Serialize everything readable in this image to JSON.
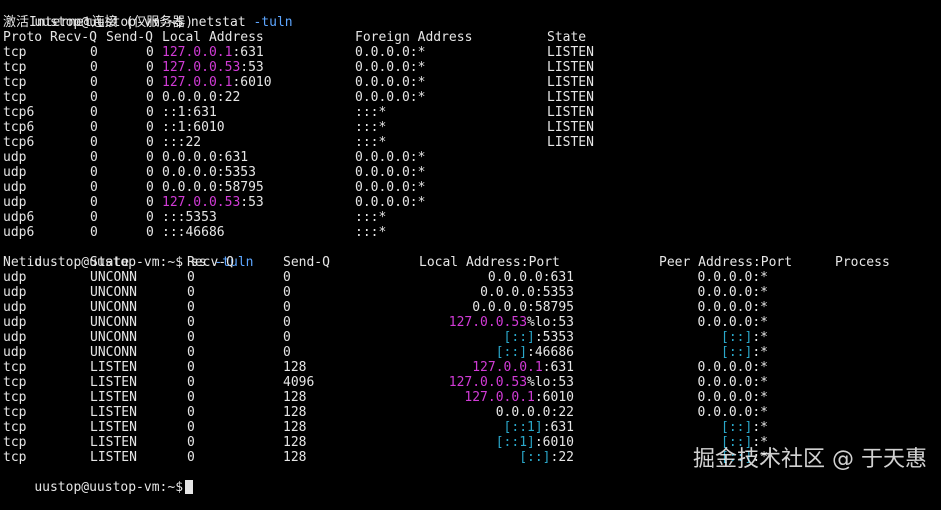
{
  "colors": {
    "background": "#000000",
    "text": "#e6e6e6",
    "ip_loopback": "#d13bd6",
    "ipv6_brackets": "#2aa7c9",
    "command_option": "#5da6ff"
  },
  "netstat": {
    "prompt": "uustop@uustop-vm:~$",
    "command": "netstat",
    "option": "-tuln",
    "subtitle": "激活Internet连接 (仅服务器)",
    "headers": {
      "proto": "Proto",
      "recvq": "Recv-Q",
      "sendq": "Send-Q",
      "local": "Local Address",
      "foreign": "Foreign Address",
      "state": "State"
    },
    "rows": [
      {
        "proto": "tcp",
        "recvq": "0",
        "sendq": "0",
        "local_ip": "127.0.0.1",
        "local_port": ":631",
        "foreign": "0.0.0.0:*",
        "state": "LISTEN"
      },
      {
        "proto": "tcp",
        "recvq": "0",
        "sendq": "0",
        "local_ip": "127.0.0.53",
        "local_port": ":53",
        "foreign": "0.0.0.0:*",
        "state": "LISTEN"
      },
      {
        "proto": "tcp",
        "recvq": "0",
        "sendq": "0",
        "local_ip": "127.0.0.1",
        "local_port": ":6010",
        "foreign": "0.0.0.0:*",
        "state": "LISTEN"
      },
      {
        "proto": "tcp",
        "recvq": "0",
        "sendq": "0",
        "local_ip": "",
        "local_port": "0.0.0.0:22",
        "foreign": "0.0.0.0:*",
        "state": "LISTEN"
      },
      {
        "proto": "tcp6",
        "recvq": "0",
        "sendq": "0",
        "local_ip": "",
        "local_port": "::1:631",
        "foreign": ":::*",
        "state": "LISTEN"
      },
      {
        "proto": "tcp6",
        "recvq": "0",
        "sendq": "0",
        "local_ip": "",
        "local_port": "::1:6010",
        "foreign": ":::*",
        "state": "LISTEN"
      },
      {
        "proto": "tcp6",
        "recvq": "0",
        "sendq": "0",
        "local_ip": "",
        "local_port": ":::22",
        "foreign": ":::*",
        "state": "LISTEN"
      },
      {
        "proto": "udp",
        "recvq": "0",
        "sendq": "0",
        "local_ip": "",
        "local_port": "0.0.0.0:631",
        "foreign": "0.0.0.0:*",
        "state": ""
      },
      {
        "proto": "udp",
        "recvq": "0",
        "sendq": "0",
        "local_ip": "",
        "local_port": "0.0.0.0:5353",
        "foreign": "0.0.0.0:*",
        "state": ""
      },
      {
        "proto": "udp",
        "recvq": "0",
        "sendq": "0",
        "local_ip": "",
        "local_port": "0.0.0.0:58795",
        "foreign": "0.0.0.0:*",
        "state": ""
      },
      {
        "proto": "udp",
        "recvq": "0",
        "sendq": "0",
        "local_ip": "127.0.0.53",
        "local_port": ":53",
        "foreign": "0.0.0.0:*",
        "state": ""
      },
      {
        "proto": "udp6",
        "recvq": "0",
        "sendq": "0",
        "local_ip": "",
        "local_port": ":::5353",
        "foreign": ":::*",
        "state": ""
      },
      {
        "proto": "udp6",
        "recvq": "0",
        "sendq": "0",
        "local_ip": "",
        "local_port": ":::46686",
        "foreign": ":::*",
        "state": ""
      }
    ]
  },
  "ss": {
    "prompt": "uustop@uustop-vm:~$",
    "command": "ss",
    "option": "-tuln",
    "headers": {
      "netid": "Netid",
      "state": "State",
      "recvq": "Recv-Q",
      "sendq": "Send-Q",
      "local": "Local Address:Port",
      "peer": "Peer Address:Port",
      "process": "Process"
    },
    "rows": [
      {
        "netid": "udp",
        "state": "UNCONN",
        "recvq": "0",
        "sendq": "0",
        "local_a": "",
        "local_b": "",
        "local_c": "0.0.0.0:631",
        "peer_a": "",
        "peer_b": "0.0.0.0:*"
      },
      {
        "netid": "udp",
        "state": "UNCONN",
        "recvq": "0",
        "sendq": "0",
        "local_a": "",
        "local_b": "",
        "local_c": "0.0.0.0:5353",
        "peer_a": "",
        "peer_b": "0.0.0.0:*"
      },
      {
        "netid": "udp",
        "state": "UNCONN",
        "recvq": "0",
        "sendq": "0",
        "local_a": "",
        "local_b": "",
        "local_c": "0.0.0.0:58795",
        "peer_a": "",
        "peer_b": "0.0.0.0:*"
      },
      {
        "netid": "udp",
        "state": "UNCONN",
        "recvq": "0",
        "sendq": "0",
        "local_a": "127.0.0.53",
        "local_b": "",
        "local_c": "%lo:53",
        "peer_a": "",
        "peer_b": "0.0.0.0:*"
      },
      {
        "netid": "udp",
        "state": "UNCONN",
        "recvq": "0",
        "sendq": "0",
        "local_a": "",
        "local_b": "[::]",
        "local_c": ":5353",
        "peer_a": "[::]",
        "peer_b": ":*"
      },
      {
        "netid": "udp",
        "state": "UNCONN",
        "recvq": "0",
        "sendq": "0",
        "local_a": "",
        "local_b": "[::]",
        "local_c": ":46686",
        "peer_a": "[::]",
        "peer_b": ":*"
      },
      {
        "netid": "tcp",
        "state": "LISTEN",
        "recvq": "0",
        "sendq": "128",
        "local_a": "127.0.0.1",
        "local_b": "",
        "local_c": ":631",
        "peer_a": "",
        "peer_b": "0.0.0.0:*"
      },
      {
        "netid": "tcp",
        "state": "LISTEN",
        "recvq": "0",
        "sendq": "4096",
        "local_a": "127.0.0.53",
        "local_b": "",
        "local_c": "%lo:53",
        "peer_a": "",
        "peer_b": "0.0.0.0:*"
      },
      {
        "netid": "tcp",
        "state": "LISTEN",
        "recvq": "0",
        "sendq": "128",
        "local_a": "127.0.0.1",
        "local_b": "",
        "local_c": ":6010",
        "peer_a": "",
        "peer_b": "0.0.0.0:*"
      },
      {
        "netid": "tcp",
        "state": "LISTEN",
        "recvq": "0",
        "sendq": "128",
        "local_a": "",
        "local_b": "",
        "local_c": "0.0.0.0:22",
        "peer_a": "",
        "peer_b": "0.0.0.0:*"
      },
      {
        "netid": "tcp",
        "state": "LISTEN",
        "recvq": "0",
        "sendq": "128",
        "local_a": "",
        "local_b": "[::1]",
        "local_c": ":631",
        "peer_a": "[::]",
        "peer_b": ":*"
      },
      {
        "netid": "tcp",
        "state": "LISTEN",
        "recvq": "0",
        "sendq": "128",
        "local_a": "",
        "local_b": "[::1]",
        "local_c": ":6010",
        "peer_a": "[::]",
        "peer_b": ":*"
      },
      {
        "netid": "tcp",
        "state": "LISTEN",
        "recvq": "0",
        "sendq": "128",
        "local_a": "",
        "local_b": "[::]",
        "local_c": ":22",
        "peer_a": "[::]",
        "peer_b": ":*"
      }
    ]
  },
  "final_prompt": "uustop@uustop-vm:~$",
  "watermark": "掘金技术社区 @ 于天惠"
}
